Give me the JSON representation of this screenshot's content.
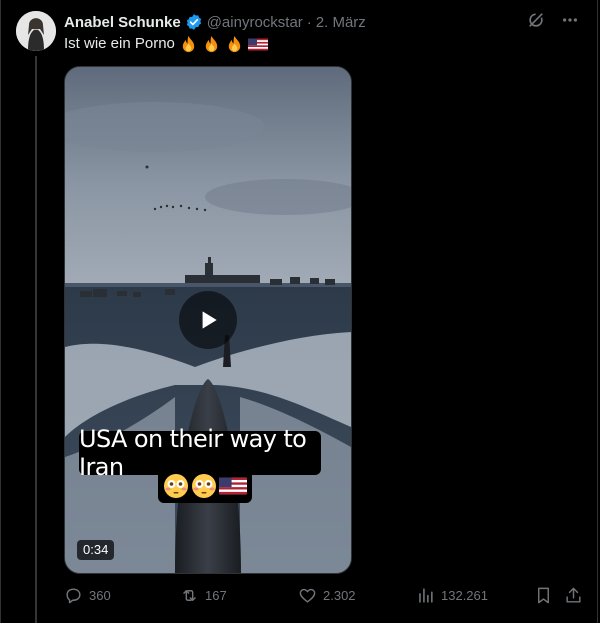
{
  "tweet": {
    "author_name": "Anabel Schunke",
    "handle": "@ainyrockstar",
    "separator": "·",
    "date": "2. März",
    "text": "Ist wie ein Porno",
    "text_emojis": [
      "fire-emoji",
      "fire-emoji",
      "fire-emoji",
      "us-flag-emoji"
    ]
  },
  "media": {
    "caption": "USA on their way to Iran",
    "caption_emojis": [
      "flushed-face-emoji",
      "flushed-face-emoji",
      "us-flag-emoji"
    ],
    "duration": "0:34"
  },
  "actions": {
    "replies": "360",
    "reposts": "167",
    "likes": "2.302",
    "views": "132.261"
  },
  "colors": {
    "background": "#000000",
    "text": "#e7e9ea",
    "muted": "#71767b",
    "verified": "#1d9bf0",
    "border": "#2f3336"
  }
}
